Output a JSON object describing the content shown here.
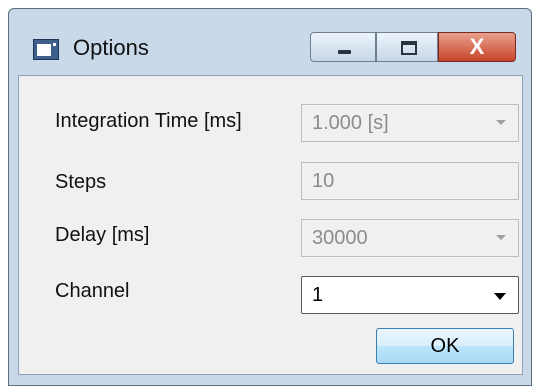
{
  "window": {
    "title": "Options",
    "icon": "window-app-icon",
    "controls": {
      "minimize_icon": "minimize-icon",
      "maximize_icon": "maximize-icon",
      "close_label": "X"
    }
  },
  "form": {
    "integration_time": {
      "label": "Integration Time [ms]",
      "value": "1.000 [s]",
      "enabled": false
    },
    "steps": {
      "label": "Steps",
      "value": "10",
      "enabled": false
    },
    "delay": {
      "label": "Delay [ms]",
      "value": "30000",
      "enabled": false
    },
    "channel": {
      "label": "Channel",
      "value": "1",
      "enabled": true
    }
  },
  "buttons": {
    "ok_label": "OK"
  },
  "colors": {
    "title_bar": "#c9d9ea",
    "client_bg": "#f0f0f0",
    "close_button": "#c8442a",
    "ok_border": "#3c7fb1"
  }
}
